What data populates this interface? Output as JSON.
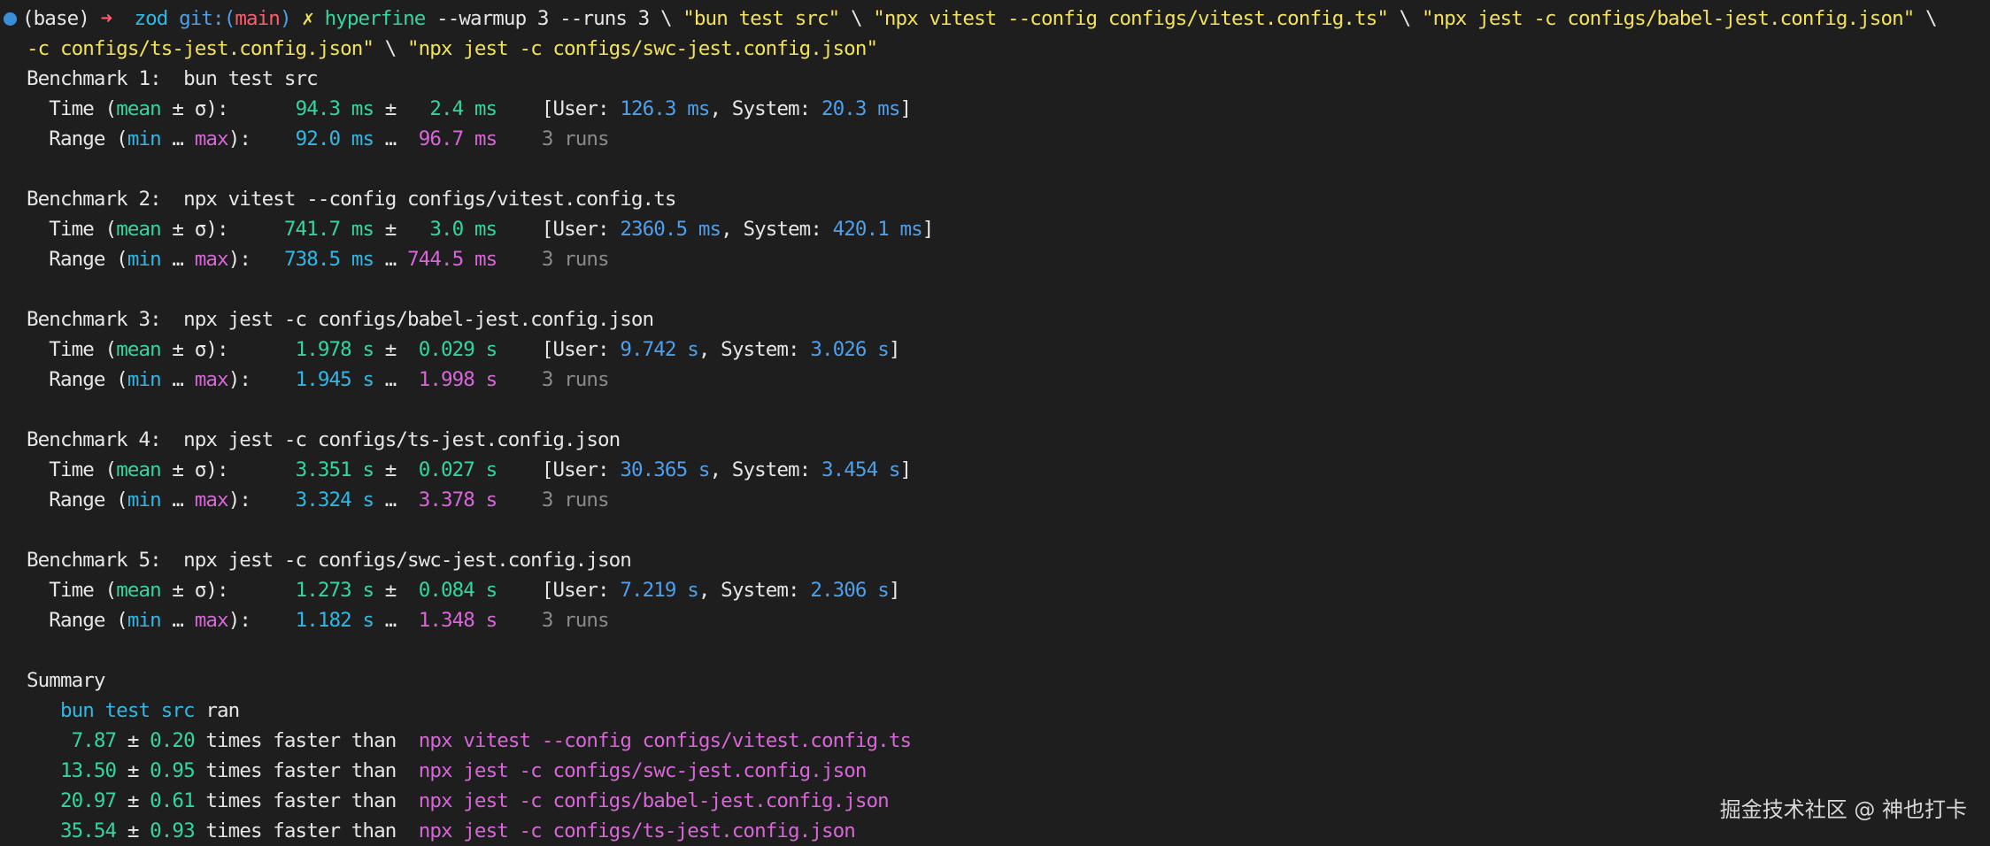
{
  "prompt": {
    "env": "(base)",
    "arrow": "➜",
    "dir": "zod",
    "git_label": "git:(",
    "branch": "main",
    "git_close": ")",
    "dirty_mark": "✗"
  },
  "command": {
    "program": "hyperfine",
    "args": "--warmup 3 --runs 3 \\ ",
    "arg1": "\"bun test src\"",
    "sep1": " \\ ",
    "arg2": "\"npx vitest --config configs/vitest.config.ts\"",
    "sep2": " \\ ",
    "arg3": "\"npx jest -c configs/babel-jest.config.json\"",
    "sep3": " \\",
    "arg4": "-c configs/ts-jest.config.json\"",
    "sep4": " \\ ",
    "arg5": "\"npx jest -c configs/swc-jest.config.json\""
  },
  "labels": {
    "time_prefix": "Time (",
    "mean": "mean",
    "pm_sigma": " ± σ):",
    "range_prefix": "Range (",
    "min": "min",
    "ellipsis": " … ",
    "max": "max",
    "range_suffix": "):",
    "user_open": "[User: ",
    "system_sep": ", System: ",
    "bracket_close": "]",
    "pm": " ± ",
    "summary": "Summary",
    "ran": "ran",
    "faster": "times faster than"
  },
  "benchmarks": [
    {
      "header": "Benchmark 1:",
      "command": "bun test src",
      "mean": "94.3 ms",
      "sigma": "2.4 ms",
      "user": "126.3 ms",
      "system": "20.3 ms",
      "min": "92.0 ms",
      "max": "96.7 ms",
      "runs": "3 runs"
    },
    {
      "header": "Benchmark 2:",
      "command": "npx vitest --config configs/vitest.config.ts",
      "mean": "741.7 ms",
      "sigma": "3.0 ms",
      "user": "2360.5 ms",
      "system": "420.1 ms",
      "min": "738.5 ms",
      "max": "744.5 ms",
      "runs": "3 runs"
    },
    {
      "header": "Benchmark 3:",
      "command": "npx jest -c configs/babel-jest.config.json",
      "mean": "1.978 s",
      "sigma": "0.029 s",
      "user": "9.742 s",
      "system": "3.026 s",
      "min": "1.945 s",
      "max": "1.998 s",
      "runs": "3 runs"
    },
    {
      "header": "Benchmark 4:",
      "command": "npx jest -c configs/ts-jest.config.json",
      "mean": "3.351 s",
      "sigma": "0.027 s",
      "user": "30.365 s",
      "system": "3.454 s",
      "min": "3.324 s",
      "max": "3.378 s",
      "runs": "3 runs"
    },
    {
      "header": "Benchmark 5:",
      "command": "npx jest -c configs/swc-jest.config.json",
      "mean": "1.273 s",
      "sigma": "0.084 s",
      "user": "7.219 s",
      "system": "2.306 s",
      "min": "1.182 s",
      "max": "1.348 s",
      "runs": "3 runs"
    }
  ],
  "summary": {
    "fastest": "bun test src",
    "comparisons": [
      {
        "factor": "7.87",
        "err": "0.20",
        "command": "npx vitest --config configs/vitest.config.ts"
      },
      {
        "factor": "13.50",
        "err": "0.95",
        "command": "npx jest -c configs/swc-jest.config.json"
      },
      {
        "factor": "20.97",
        "err": "0.61",
        "command": "npx jest -c configs/babel-jest.config.json"
      },
      {
        "factor": "35.54",
        "err": "0.93",
        "command": "npx jest -c configs/ts-jest.config.json"
      }
    ]
  },
  "watermark": "掘金技术社区 @ 神也打卡",
  "colors": {
    "background": "#1e1e1e",
    "mean": "#34d6a0",
    "min": "#2fb8e6",
    "user_system": "#4f9fea",
    "max": "#d866d8",
    "command_string": "#f2e25a",
    "arrow": "#ff5c6c",
    "runs": "#8a8a8a",
    "status_dot": "#3b8fd8"
  }
}
